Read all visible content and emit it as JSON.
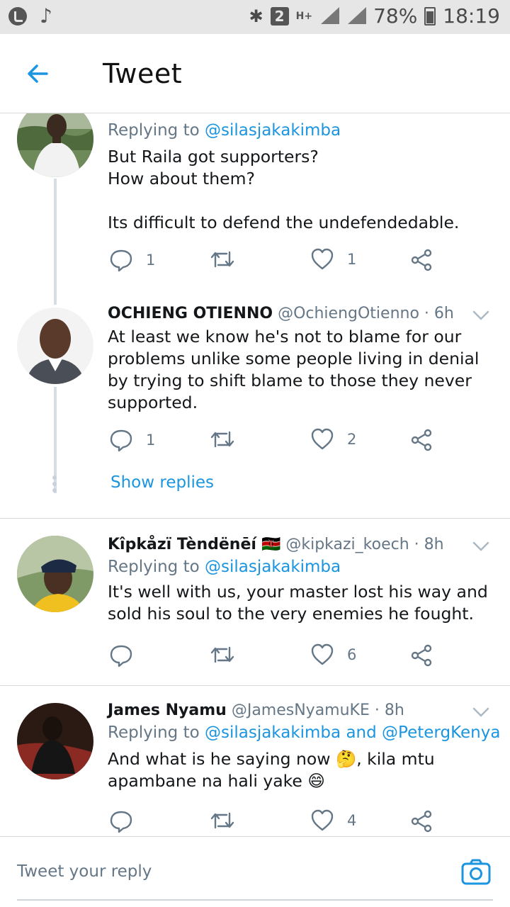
{
  "status_bar": {
    "bluetooth_icon": "bluetooth-icon",
    "sim_badge": "2",
    "network_type": "H+",
    "battery_percent": "78%",
    "time": "18:19"
  },
  "header": {
    "title": "Tweet",
    "back_icon": "arrow-left-icon"
  },
  "tweets": [
    {
      "replying_prefix": "Replying to",
      "replying_to": "@silasjakakimba",
      "text": "But Raila got supporters?\nHow about them?\n\nIts difficult to defend the undefendedable.",
      "counts": {
        "replies": "1",
        "retweets": "",
        "likes": "1"
      }
    },
    {
      "name": "OCHIENG OTIENNO",
      "handle": "@OchiengOtienno",
      "time": "· 6h",
      "text": "At least we know he's not to blame for our problems unlike some people living in denial by trying to shift blame to those they never supported.",
      "counts": {
        "replies": "1",
        "retweets": "",
        "likes": "2"
      },
      "show_replies": "Show replies"
    },
    {
      "name": "Kîpkåzï Tèndënēí",
      "flag": "🇰🇪",
      "handle": "@kipkazi_koech",
      "time": "· 8h",
      "replying_prefix": "Replying to",
      "replying_to": "@silasjakakimba",
      "text": "It's well with us, your master lost his way and sold his soul to the very enemies he fought.",
      "counts": {
        "replies": "",
        "retweets": "",
        "likes": "6"
      }
    },
    {
      "name": "James Nyamu",
      "handle": "@JamesNyamuKE",
      "time": "· 8h",
      "replying_prefix": "Replying to",
      "replying_to": "@silasjakakimba",
      "replying_and": "and",
      "replying_to_2": "@PetergKenya",
      "text": "And what is he saying now 🤔, kila mtu apambane na hali yake 😄",
      "counts": {
        "replies": "",
        "retweets": "",
        "likes": "4"
      }
    }
  ],
  "composer": {
    "placeholder": "Tweet your reply",
    "camera_icon": "camera-icon"
  },
  "colors": {
    "accent": "#1b95e0",
    "secondary_text": "#657786",
    "primary_text": "#14171a",
    "divider": "#d9d9d9"
  }
}
